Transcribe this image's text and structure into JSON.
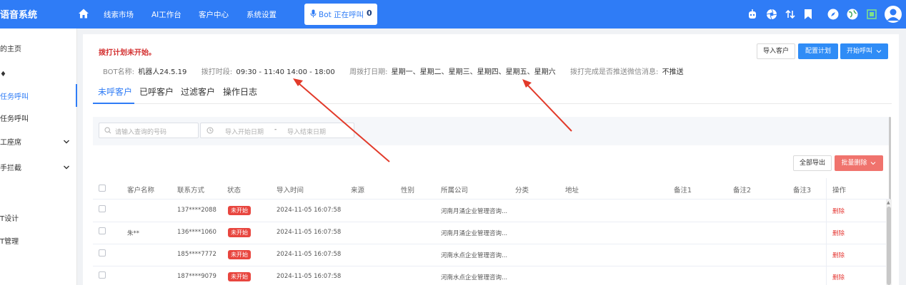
{
  "header": {
    "brand": "语音系统",
    "nav": [
      "线索市场",
      "AI工作台",
      "客户中心",
      "系统设置"
    ],
    "bot_status_label": "Bot 正在呼叫",
    "bot_status_count": "0"
  },
  "sidebar": {
    "items": [
      {
        "label": "的主页"
      },
      {
        "label": "♦"
      },
      {
        "label": "任务呼叫"
      },
      {
        "label": "任务呼叫"
      },
      {
        "label": "工座席"
      },
      {
        "label": "手拦截"
      },
      {
        "label": "T设计"
      },
      {
        "label": "T管理"
      }
    ]
  },
  "plan": {
    "status": "拨打计划未开始。",
    "bot_name_label": "BOT名称:",
    "bot_name": "机器人24.5.19",
    "time_label": "拨打时段:",
    "time_value": "09:30 - 11:40 14:00 - 18:00",
    "days_label": "周拨打日期:",
    "days_value": "星期一、星期二、星期三、星期四、星期五、星期六",
    "wechat_label": "拨打完成是否推送微信消息:",
    "wechat_value": "不推送"
  },
  "buttons": {
    "import": "导入客户",
    "config": "配置计划",
    "start": "开始呼叫",
    "export_all": "全部导出",
    "batch_delete": "批量删除"
  },
  "tabs": [
    "未呼客户",
    "已呼客户",
    "过滤客户",
    "操作日志"
  ],
  "filters": {
    "search_placeholder": "请输入查询的号码",
    "start_date_placeholder": "导入开始日期",
    "date_separator": "-",
    "end_date_placeholder": "导入结束日期"
  },
  "table": {
    "headers": [
      "客户名称",
      "联系方式",
      "状态",
      "导入时间",
      "来源",
      "性别",
      "所属公司",
      "分类",
      "地址",
      "备注1",
      "备注2",
      "备注3",
      "操作"
    ],
    "rows": [
      {
        "name": "",
        "phone": "137****2088",
        "status": "未开始",
        "time": "2024-11-05 16:07:58",
        "company": "河南月涌企业管理咨询...",
        "action": "删除"
      },
      {
        "name": "朱**",
        "phone": "136****1060",
        "status": "未开始",
        "time": "2024-11-05 16:07:58",
        "company": "河南月涌企业管理咨询...",
        "action": "删除"
      },
      {
        "name": "",
        "phone": "185****7772",
        "status": "未开始",
        "time": "2024-11-05 16:07:58",
        "company": "河南水点企业管理咨询...",
        "action": "删除"
      },
      {
        "name": "",
        "phone": "187****9079",
        "status": "未开始",
        "time": "2024-11-05 16:07:58",
        "company": "河南水点企业管理咨询...",
        "action": "删除"
      }
    ]
  },
  "colors": {
    "primary": "#2f7cf6",
    "danger": "#e8463f",
    "annotation_arrow": "#e23a2a"
  }
}
